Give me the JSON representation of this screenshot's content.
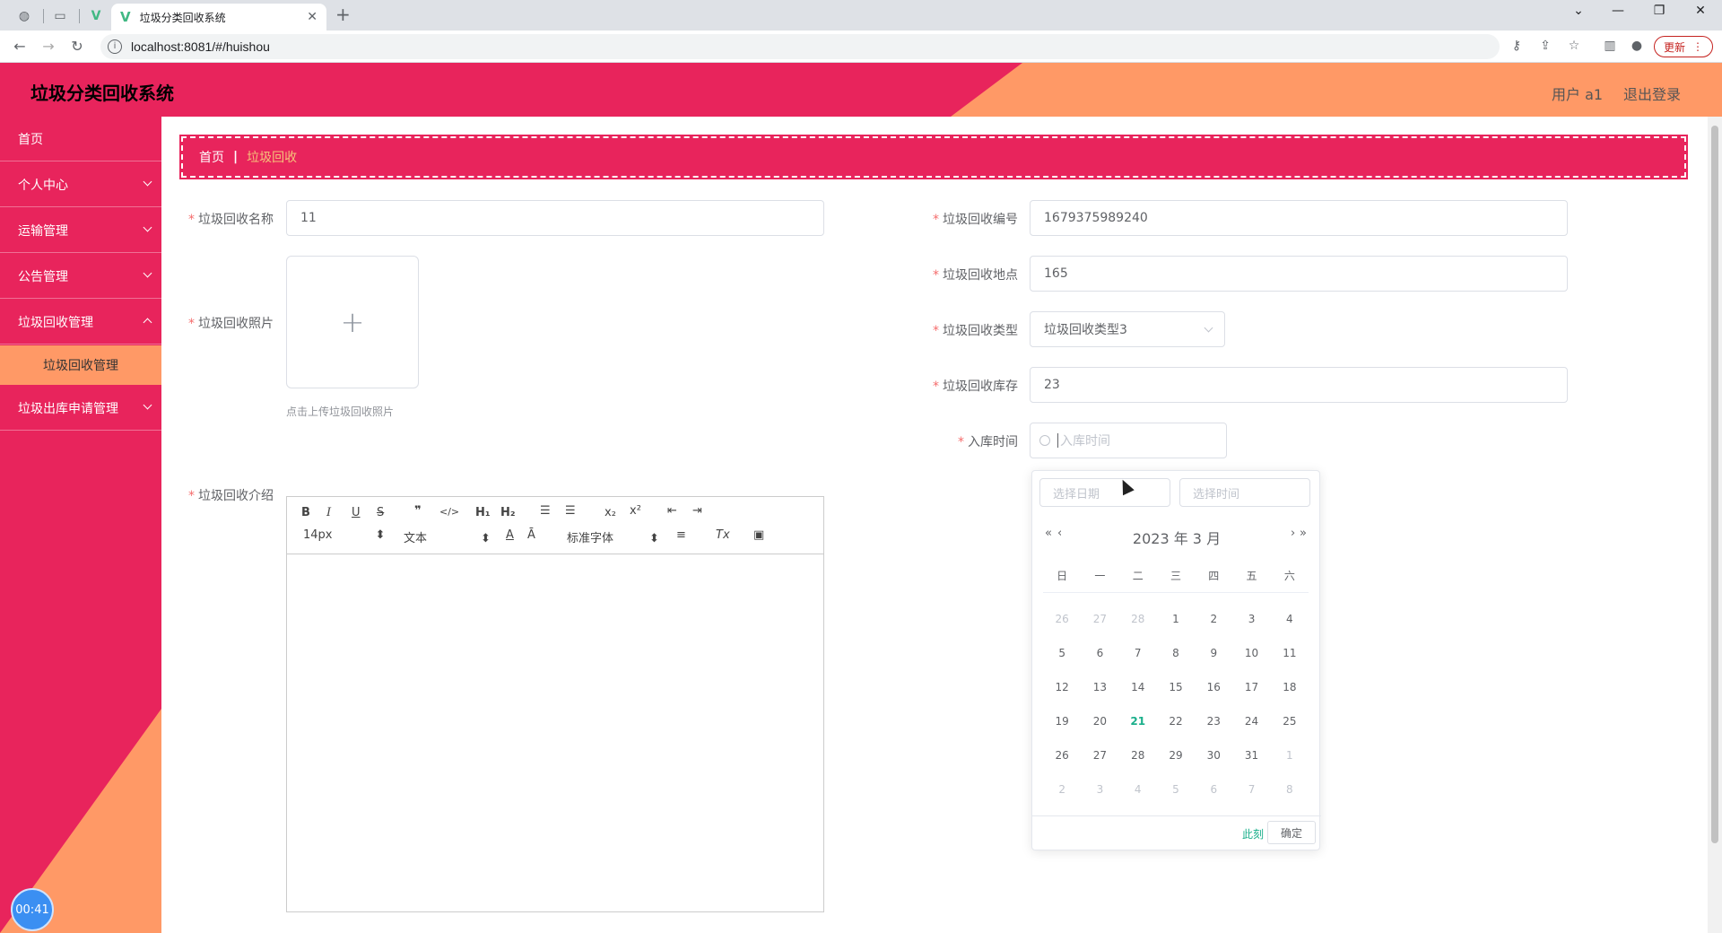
{
  "browser": {
    "tab_title": "垃圾分类回收系统",
    "url": "localhost:8081/#/huishou",
    "update_label": "更新"
  },
  "header": {
    "title": "垃圾分类回收系统",
    "user": "用户 a1",
    "logout": "退出登录"
  },
  "sidebar": {
    "items": [
      "首页",
      "个人中心",
      "运输管理",
      "公告管理",
      "垃圾回收管理",
      "垃圾出库申请管理"
    ],
    "sub_item": "垃圾回收管理",
    "timer": "00:41"
  },
  "breadcrumb": {
    "home": "首页",
    "current": "垃圾回收"
  },
  "form": {
    "name_label": "垃圾回收名称",
    "name_value": "11",
    "photo_label": "垃圾回收照片",
    "photo_tip": "点击上传垃圾回收照片",
    "intro_label": "垃圾回收介绍",
    "code_label": "垃圾回收编号",
    "code_value": "1679375989240",
    "location_label": "垃圾回收地点",
    "location_value": "165",
    "type_label": "垃圾回收类型",
    "type_value": "垃圾回收类型3",
    "stock_label": "垃圾回收库存",
    "stock_value": "23",
    "time_label": "入库时间",
    "time_placeholder": "入库时间"
  },
  "editor": {
    "font_size": "14px",
    "paragraph": "文本",
    "font_family": "标准字体"
  },
  "datepicker": {
    "date_placeholder": "选择日期",
    "time_placeholder": "选择时间",
    "title": "2023 年  3 月",
    "weekdays": [
      "日",
      "一",
      "二",
      "三",
      "四",
      "五",
      "六"
    ],
    "days": [
      [
        "26",
        "27",
        "28",
        "1",
        "2",
        "3",
        "4"
      ],
      [
        "5",
        "6",
        "7",
        "8",
        "9",
        "10",
        "11"
      ],
      [
        "12",
        "13",
        "14",
        "15",
        "16",
        "17",
        "18"
      ],
      [
        "19",
        "20",
        "21",
        "22",
        "23",
        "24",
        "25"
      ],
      [
        "26",
        "27",
        "28",
        "29",
        "30",
        "31",
        "1"
      ],
      [
        "2",
        "3",
        "4",
        "5",
        "6",
        "7",
        "8"
      ]
    ],
    "today": "21",
    "now_label": "此刻",
    "ok_label": "确定"
  }
}
